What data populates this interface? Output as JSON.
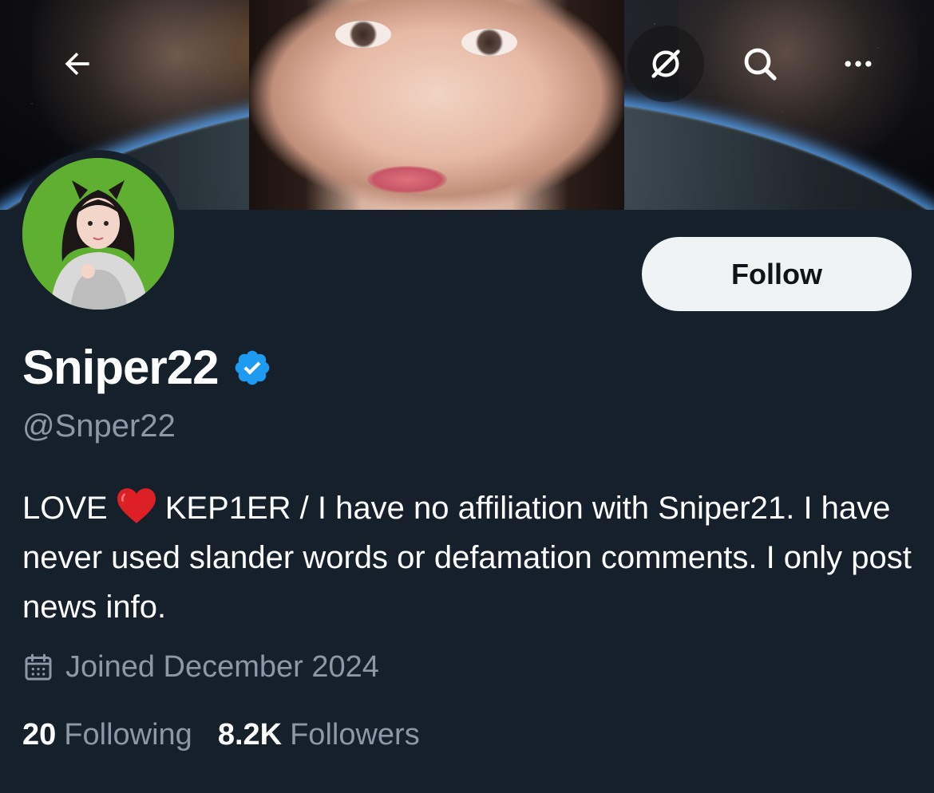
{
  "header": {
    "back_icon": "arrow-left-icon",
    "grok_icon": "grok-icon",
    "search_icon": "search-icon",
    "more_icon": "more-horizontal-icon"
  },
  "profile": {
    "display_name": "Sniper22",
    "verified": true,
    "handle": "@Snper22",
    "follow_label": "Follow",
    "bio": {
      "part1": "LOVE",
      "heart": "❤️",
      "part2": "KEP1ER / I have no affiliation with Sniper21. I have never used slander words or defamation comments. I only post news info."
    },
    "joined": "Joined December 2024",
    "following_count": "20",
    "following_label": "Following",
    "followers_count": "8.2K",
    "followers_label": "Followers"
  },
  "colors": {
    "background": "#15202b",
    "secondary_text": "#8b98a5",
    "verified_blue": "#1d9bf0",
    "follow_bg": "#eff3f4"
  }
}
